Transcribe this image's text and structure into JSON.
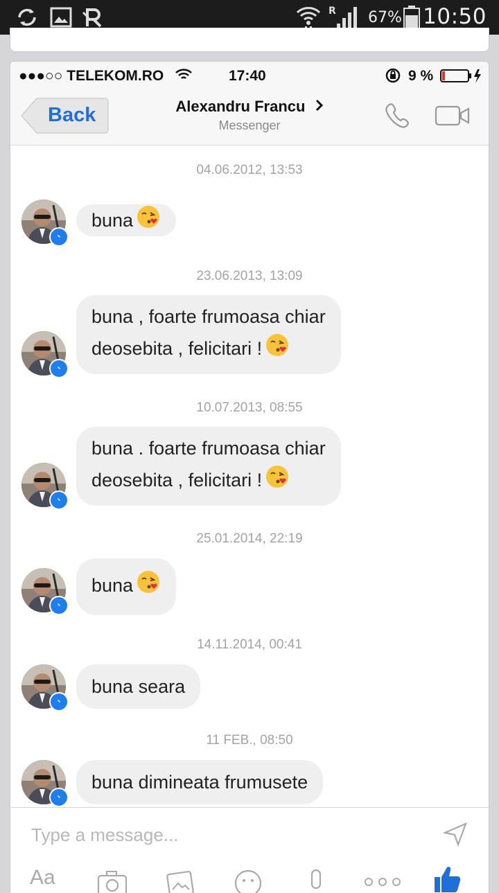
{
  "android_status": {
    "battery_percent": "67%",
    "time": "10:50"
  },
  "ios_status": {
    "carrier": "●●●○○ TELEKOM.RO",
    "time": "17:40",
    "battery": "9 %"
  },
  "nav": {
    "back_label": "Back",
    "contact_name": "Alexandru Francu",
    "subtitle": "Messenger"
  },
  "messages": [
    {
      "timestamp": "04.06.2012, 13:53",
      "lines": [
        "buna"
      ],
      "emoji": true
    },
    {
      "timestamp": "23.06.2013, 13:09",
      "lines": [
        "buna , foarte frumoasa chiar",
        "deosebita , felicitari !"
      ],
      "emoji": true
    },
    {
      "timestamp": "10.07.2013, 08:55",
      "lines": [
        "buna . foarte frumoasa chiar",
        "deosebita , felicitari !"
      ],
      "emoji": true
    },
    {
      "timestamp": "25.01.2014, 22:19",
      "lines": [
        "buna"
      ],
      "emoji": true
    },
    {
      "timestamp": "14.11.2014, 00:41",
      "lines": [
        "buna seara"
      ],
      "emoji": false
    },
    {
      "timestamp": "11 FEB., 08:50",
      "lines": [
        "buna dimineata frumusete"
      ],
      "emoji": false
    }
  ],
  "composer": {
    "placeholder": "Type a message...",
    "text_format_label": "Aa"
  },
  "colors": {
    "accent": "#1f6fd8",
    "messenger_badge": "#1e7ef0",
    "bubble": "#efefef"
  },
  "icons": [
    "sync-icon",
    "image-icon",
    "r-icon",
    "wifi-icon",
    "signal-icon",
    "battery-icon",
    "phone-icon",
    "video-icon",
    "send-icon",
    "camera-icon",
    "gallery-icon",
    "sticker-icon",
    "mic-icon",
    "more-icon",
    "like-icon"
  ]
}
